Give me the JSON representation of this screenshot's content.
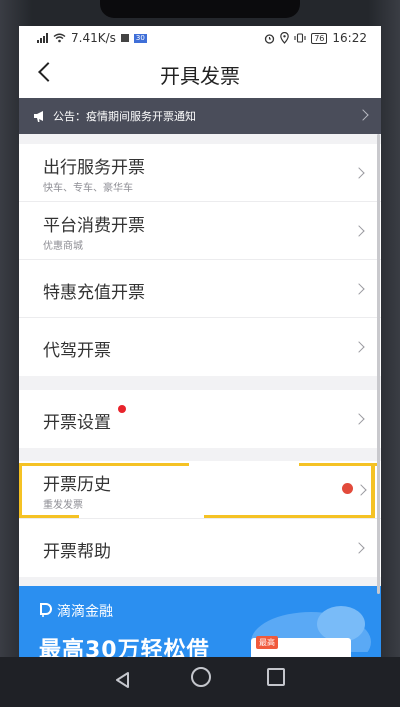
{
  "status_bar": {
    "speed": "7.41K/s",
    "notif_badge": "30",
    "battery": "76",
    "time": "16:22"
  },
  "header": {
    "title": "开具发票"
  },
  "notice": {
    "text": "公告：疫情期间服务开票通知"
  },
  "groups": [
    {
      "items": [
        {
          "title": "出行服务开票",
          "subtitle": "快车、专车、豪华车"
        },
        {
          "title": "平台消费开票",
          "subtitle": "优惠商城"
        },
        {
          "title": "特惠充值开票"
        },
        {
          "title": "代驾开票"
        }
      ]
    },
    {
      "items": [
        {
          "title": "开票设置"
        }
      ]
    },
    {
      "items": [
        {
          "title": "开票历史",
          "subtitle": "重发发票"
        },
        {
          "title": "开票帮助"
        }
      ]
    }
  ],
  "banner": {
    "brand": "滴滴金融",
    "slogan": "最高30万轻松借",
    "tag": "最高"
  },
  "colors": {
    "header_bg": "#ffffff",
    "notice_bg": "#4a4d5a",
    "banner_bg": "#2b8ff0",
    "dot_red": "#e8232b",
    "highlight": "#f5c224"
  },
  "icons": [
    "back-arrow-icon",
    "megaphone-icon",
    "chevron-right-icon",
    "didi-logo-icon",
    "nav-back-icon",
    "nav-home-icon",
    "nav-recent-icon",
    "wifi-icon",
    "signal-icon",
    "alarm-icon",
    "location-icon",
    "battery-icon"
  ]
}
